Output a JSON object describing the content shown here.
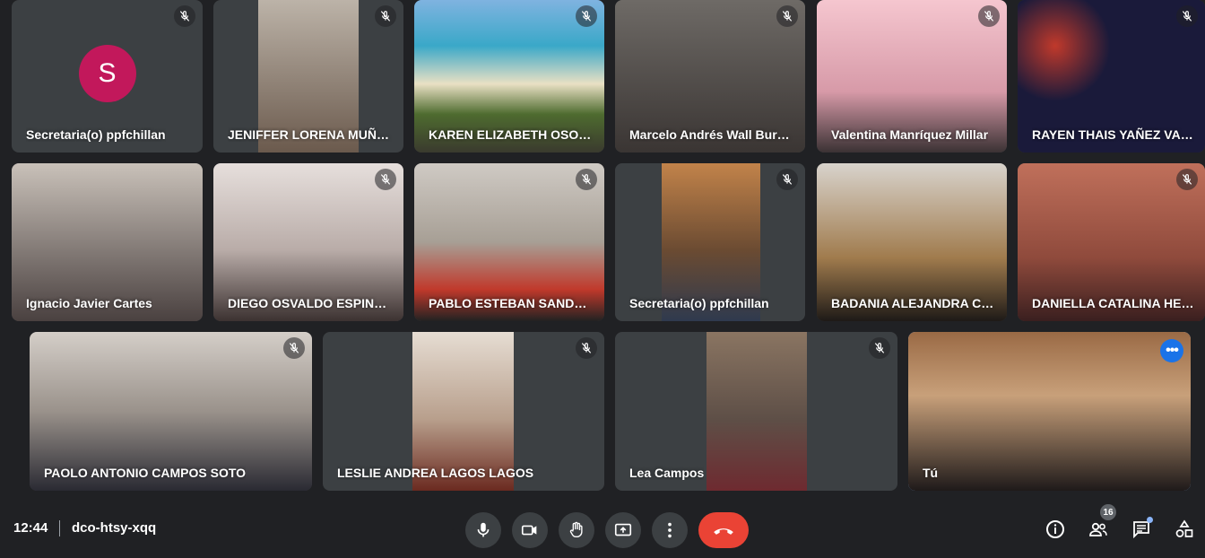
{
  "meeting": {
    "time": "12:44",
    "code": "dco-htsy-xqq"
  },
  "row1": [
    {
      "name": "Secretaria(o) ppfchillan",
      "initial": "S",
      "muted": true
    },
    {
      "name": "JENIFFER LORENA MUÑO...",
      "muted": true
    },
    {
      "name": "KAREN ELIZABETH OSORI...",
      "muted": true
    },
    {
      "name": "Marcelo Andrés Wall Burgos",
      "muted": true
    },
    {
      "name": "Valentina Manríquez Millar",
      "muted": true
    },
    {
      "name": "RAYEN THAIS YAÑEZ VALD...",
      "muted": true
    }
  ],
  "row2": [
    {
      "name": "Ignacio Javier Cartes",
      "muted": false
    },
    {
      "name": "DIEGO OSVALDO ESPINO...",
      "muted": true
    },
    {
      "name": "PABLO ESTEBAN SANDOV...",
      "muted": true
    },
    {
      "name": "Secretaria(o) ppfchillan",
      "muted": true
    },
    {
      "name": "BADANIA ALEJANDRA CA...",
      "muted": false
    },
    {
      "name": "DANIELLA CATALINA HER...",
      "muted": true
    }
  ],
  "row3": [
    {
      "name": "PAOLO ANTONIO CAMPOS SOTO",
      "muted": true
    },
    {
      "name": "LESLIE ANDREA LAGOS LAGOS",
      "muted": true
    },
    {
      "name": "Lea Campos",
      "muted": true
    },
    {
      "name": "Tú",
      "muted": false
    }
  ],
  "people_count": "16",
  "more_options": "•••",
  "colors": {
    "background": "#202124",
    "tile": "#3c4043",
    "end_call": "#ea4335",
    "avatar": "#c2185b",
    "self_outline": "#8ab4f8"
  }
}
